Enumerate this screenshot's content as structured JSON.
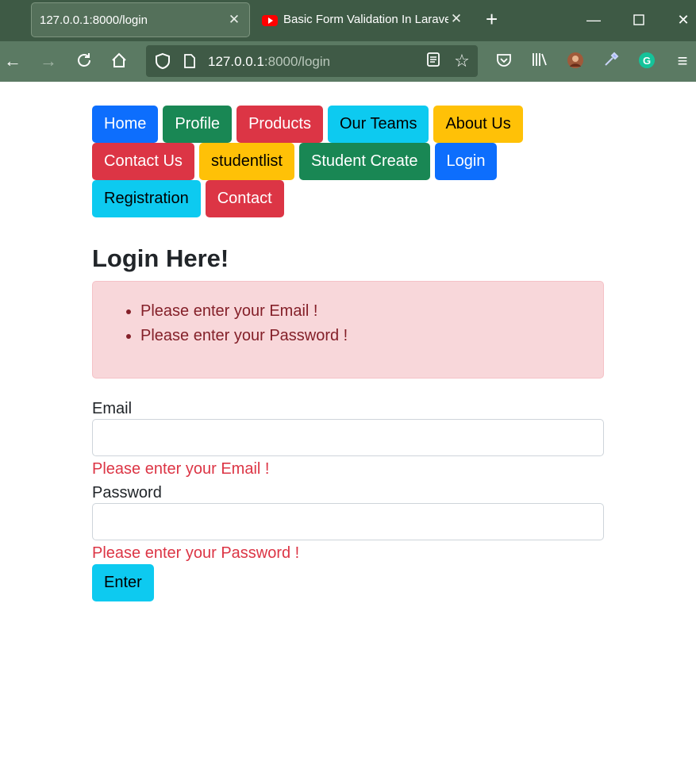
{
  "browser": {
    "tabs": [
      {
        "title": "127.0.0.1:8000/login",
        "active": true
      },
      {
        "title": "Basic Form Validation In Laravel",
        "active": false
      }
    ],
    "url": {
      "host": "127.0.0.1",
      "path": ":8000/login"
    },
    "icons": [
      "back-icon",
      "forward-icon",
      "reload-icon",
      "home-icon",
      "shield-icon",
      "page-icon",
      "reader-view-icon",
      "bookmark-star-icon",
      "pocket-icon",
      "library-icon",
      "profile-avatar-icon",
      "eyedropper-icon",
      "grammarly-icon",
      "menu-icon"
    ]
  },
  "nav": {
    "buttons": [
      {
        "label": "Home",
        "variant": "primary"
      },
      {
        "label": "Profile",
        "variant": "success"
      },
      {
        "label": "Products",
        "variant": "danger"
      },
      {
        "label": "Our Teams",
        "variant": "info"
      },
      {
        "label": "About Us",
        "variant": "warning"
      },
      {
        "label": "Contact Us",
        "variant": "danger"
      },
      {
        "label": "studentlist",
        "variant": "warning"
      },
      {
        "label": "Student Create",
        "variant": "success"
      },
      {
        "label": "Login",
        "variant": "primary"
      },
      {
        "label": "Registration",
        "variant": "info"
      },
      {
        "label": "Contact",
        "variant": "danger"
      }
    ]
  },
  "page": {
    "title": "Login Here!",
    "errors": [
      "Please enter your Email !",
      "Please enter your Password !"
    ]
  },
  "form": {
    "email_label": "Email",
    "email_value": "",
    "email_error": "Please enter your Email !",
    "password_label": "Password",
    "password_value": "",
    "password_error": "Please enter your Password !",
    "submit_label": "Enter"
  },
  "colors": {
    "primary": "#0d6efd",
    "success": "#198754",
    "danger": "#dc3545",
    "info": "#0dcaf0",
    "warning": "#ffc107",
    "alert_bg": "#f8d7da",
    "alert_text": "#842029"
  }
}
